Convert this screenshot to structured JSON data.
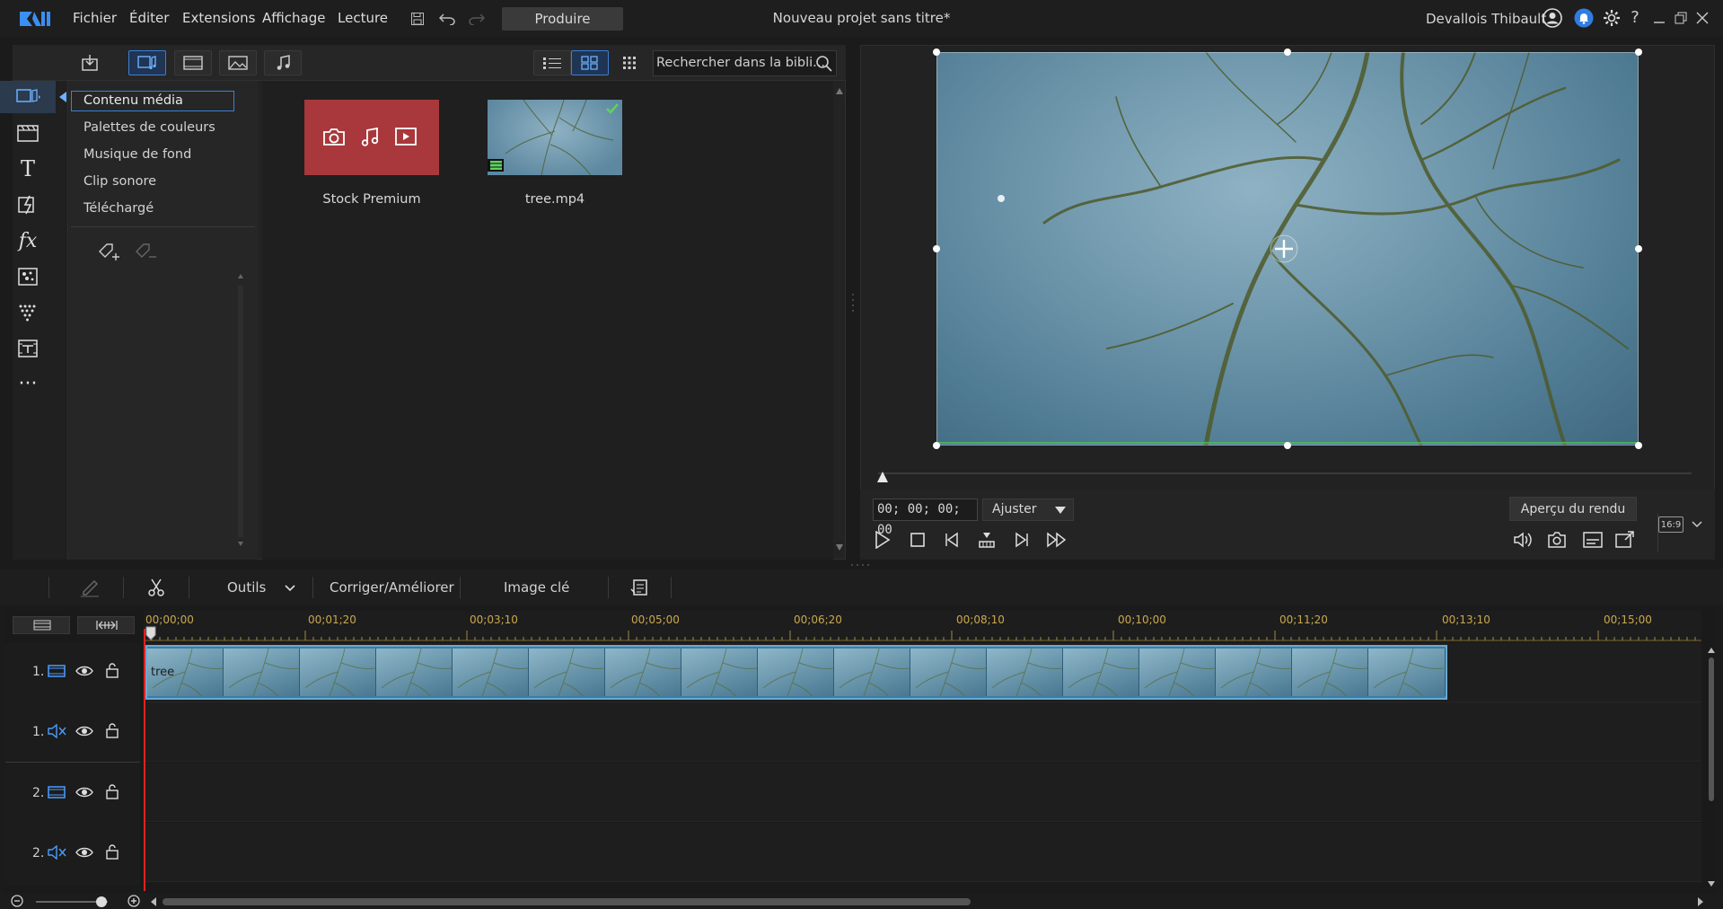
{
  "app": {
    "menu": [
      "Fichier",
      "Éditer",
      "Extensions",
      "Affichage",
      "Lecture"
    ],
    "produce_label": "Produire",
    "project_title": "Nouveau projet sans titre*",
    "user_name": "Devallois Thibault"
  },
  "library": {
    "search_placeholder": "Rechercher dans la bibli...",
    "categories": [
      "Contenu média",
      "Palettes de couleurs",
      "Musique de fond",
      "Clip sonore",
      "Téléchargé"
    ],
    "items": [
      {
        "label": "Stock Premium",
        "bg": "#a8383b"
      },
      {
        "label": "tree.mp4"
      }
    ]
  },
  "preview": {
    "timecode": "00; 00; 00; 00",
    "fit": "Ajuster",
    "render_preview": "Aperçu du rendu",
    "aspect": "16:9"
  },
  "edit_toolbar": {
    "tools": "Outils",
    "fix_enhance": "Corriger/Améliorer",
    "keyframe": "Image clé"
  },
  "timeline": {
    "ruler": [
      "00;00;00",
      "00;01;20",
      "00;03;10",
      "00;05;00",
      "00;06;20",
      "00;08;10",
      "00;10;00",
      "00;11;20",
      "00;13;10",
      "00;15;00"
    ],
    "tracks": [
      {
        "label": "1.",
        "type": "video"
      },
      {
        "label": "1.",
        "type": "audio"
      },
      {
        "label": "2.",
        "type": "video"
      },
      {
        "label": "2.",
        "type": "audio"
      }
    ],
    "clip_name": "tree"
  },
  "colors": {
    "accent": "#3d7fd6",
    "playhead": "#dd2222",
    "ruler_text": "#c9a84e"
  }
}
